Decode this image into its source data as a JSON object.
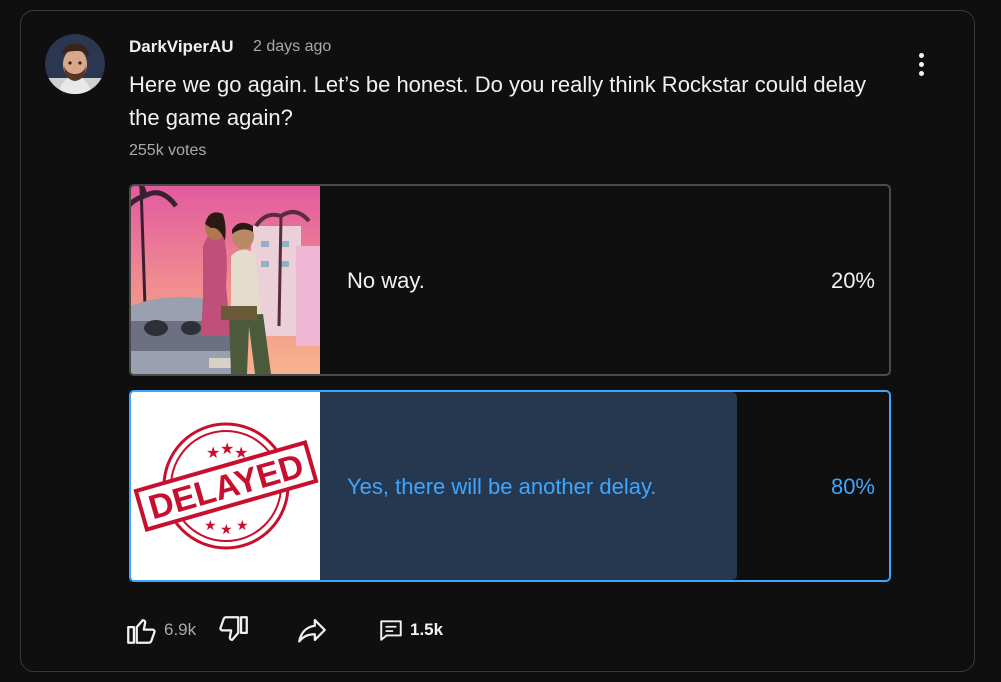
{
  "post": {
    "author": "DarkViperAU",
    "time": "2 days ago",
    "text": "Here we go again. Let’s be honest. Do you really think Rockstar could delay the game again?",
    "votes": "255k votes"
  },
  "poll": {
    "options": [
      {
        "label": "No way.",
        "percent_text": "20%",
        "percent": 20,
        "image": "gta-vi-artwork"
      },
      {
        "label": "Yes, there will be another delay.",
        "percent_text": "80%",
        "percent": 80,
        "selected": true,
        "image": "delayed-stamp"
      }
    ],
    "stamp_text": "DELAYED"
  },
  "actions": {
    "like_count": "6.9k",
    "comment_count": "1.5k"
  },
  "icons": [
    "avatar",
    "more-vert-icon",
    "thumb-up-icon",
    "thumb-down-icon",
    "share-icon",
    "comment-icon"
  ],
  "colors": {
    "accent": "#3ea6ff",
    "selected_fill": "#263850",
    "unselected_fill": "#3d3d3d",
    "stamp_red": "#c8102e"
  }
}
